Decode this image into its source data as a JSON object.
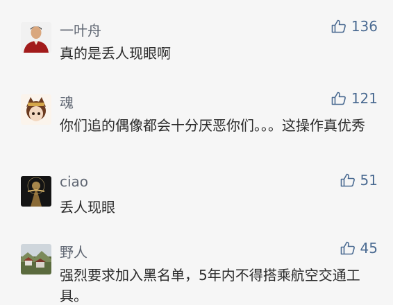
{
  "comments": [
    {
      "user": "一叶舟",
      "text": "真的是丢人现眼啊",
      "likes": "136",
      "avatar": "man-in-red-coat"
    },
    {
      "user": "魂",
      "text": "你们追的偶像都会十分厌恶你们。。。这操作真优秀",
      "likes": "121",
      "avatar": "anime-girl"
    },
    {
      "user": "ciao",
      "text": "丢人现眼",
      "likes": "51",
      "avatar": "dark-figure-with-light"
    },
    {
      "user": "野人",
      "text": "强烈要求加入黑名单，5年内不得搭乘航空交通工具。",
      "likes": "45",
      "avatar": "landscape-village"
    }
  ],
  "colors": {
    "background": "#f6f6f6",
    "username": "#5f6672",
    "comment_text": "#2b2b2b",
    "like": "#4a6a91"
  },
  "icons": {
    "like": "thumbs-up-icon"
  }
}
